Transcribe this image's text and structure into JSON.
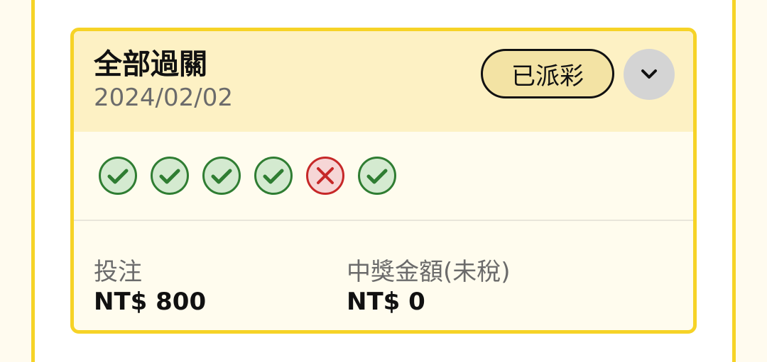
{
  "bet": {
    "title": "全部過關",
    "date": "2024/02/02",
    "status": "已派彩",
    "expand_icon": "chevron-down-icon",
    "legs": [
      {
        "result": "won",
        "icon": "check-circle-icon"
      },
      {
        "result": "won",
        "icon": "check-circle-icon"
      },
      {
        "result": "won",
        "icon": "check-circle-icon"
      },
      {
        "result": "won",
        "icon": "check-circle-icon"
      },
      {
        "result": "lost",
        "icon": "cross-circle-icon"
      },
      {
        "result": "won",
        "icon": "check-circle-icon"
      }
    ],
    "stake_label": "投注",
    "stake_value": "NT$ 800",
    "payout_label": "中獎金額(未稅)",
    "payout_value": "NT$ 0"
  },
  "colors": {
    "accent_yellow": "#f6d327",
    "header_bg": "#fdf1c4",
    "badge_bg": "#f3e3a4",
    "won_green": "#2f7d32",
    "won_fill": "#d4ead0",
    "lost_red": "#c62828",
    "lost_fill": "#f6d6d6"
  }
}
